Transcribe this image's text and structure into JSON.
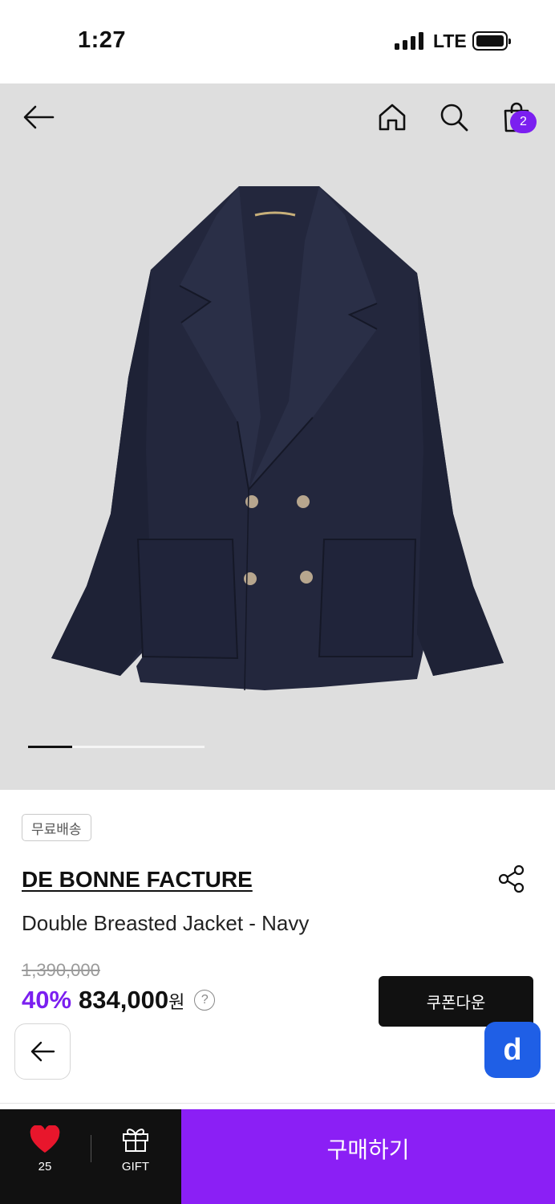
{
  "status_bar": {
    "time": "1:27",
    "network": "LTE",
    "signal_bars": 4,
    "battery_level": 1.0
  },
  "header": {
    "cart_count": "2",
    "icons": [
      "back-arrow-icon",
      "home-icon",
      "search-icon",
      "shopping-bag-icon"
    ]
  },
  "gallery": {
    "progress_fraction": 0.25
  },
  "product": {
    "badge": "무료배송",
    "brand": "DE BONNE FACTURE",
    "name": "Double Breasted Jacket - Navy",
    "original_price": "1,390,000",
    "discount": "40%",
    "final_price": "834,000",
    "currency": "원",
    "help": "?"
  },
  "actions": {
    "coupon": "쿠폰다운",
    "buy": "구매하기",
    "app_badge": "d"
  },
  "bottom_bar": {
    "like_count": "25",
    "gift_label": "GIFT"
  },
  "colors": {
    "accent": "#8b1ff5",
    "price_accent": "#7b1ff0",
    "app_blue": "#1f5fe6",
    "jacket": "#23273d"
  }
}
